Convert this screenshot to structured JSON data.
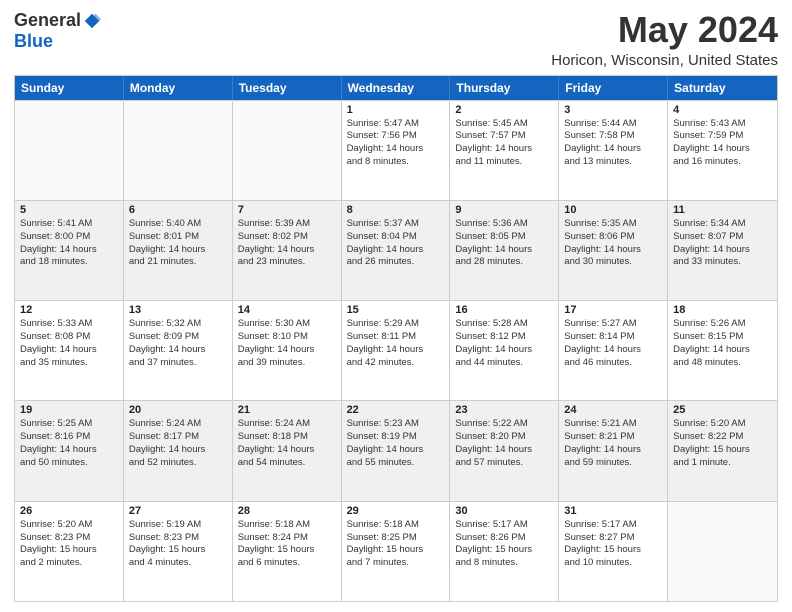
{
  "logo": {
    "general": "General",
    "blue": "Blue"
  },
  "title": "May 2024",
  "location": "Horicon, Wisconsin, United States",
  "days_of_week": [
    "Sunday",
    "Monday",
    "Tuesday",
    "Wednesday",
    "Thursday",
    "Friday",
    "Saturday"
  ],
  "weeks": [
    [
      {
        "day": "",
        "info": ""
      },
      {
        "day": "",
        "info": ""
      },
      {
        "day": "",
        "info": ""
      },
      {
        "day": "1",
        "info": "Sunrise: 5:47 AM\nSunset: 7:56 PM\nDaylight: 14 hours\nand 8 minutes."
      },
      {
        "day": "2",
        "info": "Sunrise: 5:45 AM\nSunset: 7:57 PM\nDaylight: 14 hours\nand 11 minutes."
      },
      {
        "day": "3",
        "info": "Sunrise: 5:44 AM\nSunset: 7:58 PM\nDaylight: 14 hours\nand 13 minutes."
      },
      {
        "day": "4",
        "info": "Sunrise: 5:43 AM\nSunset: 7:59 PM\nDaylight: 14 hours\nand 16 minutes."
      }
    ],
    [
      {
        "day": "5",
        "info": "Sunrise: 5:41 AM\nSunset: 8:00 PM\nDaylight: 14 hours\nand 18 minutes."
      },
      {
        "day": "6",
        "info": "Sunrise: 5:40 AM\nSunset: 8:01 PM\nDaylight: 14 hours\nand 21 minutes."
      },
      {
        "day": "7",
        "info": "Sunrise: 5:39 AM\nSunset: 8:02 PM\nDaylight: 14 hours\nand 23 minutes."
      },
      {
        "day": "8",
        "info": "Sunrise: 5:37 AM\nSunset: 8:04 PM\nDaylight: 14 hours\nand 26 minutes."
      },
      {
        "day": "9",
        "info": "Sunrise: 5:36 AM\nSunset: 8:05 PM\nDaylight: 14 hours\nand 28 minutes."
      },
      {
        "day": "10",
        "info": "Sunrise: 5:35 AM\nSunset: 8:06 PM\nDaylight: 14 hours\nand 30 minutes."
      },
      {
        "day": "11",
        "info": "Sunrise: 5:34 AM\nSunset: 8:07 PM\nDaylight: 14 hours\nand 33 minutes."
      }
    ],
    [
      {
        "day": "12",
        "info": "Sunrise: 5:33 AM\nSunset: 8:08 PM\nDaylight: 14 hours\nand 35 minutes."
      },
      {
        "day": "13",
        "info": "Sunrise: 5:32 AM\nSunset: 8:09 PM\nDaylight: 14 hours\nand 37 minutes."
      },
      {
        "day": "14",
        "info": "Sunrise: 5:30 AM\nSunset: 8:10 PM\nDaylight: 14 hours\nand 39 minutes."
      },
      {
        "day": "15",
        "info": "Sunrise: 5:29 AM\nSunset: 8:11 PM\nDaylight: 14 hours\nand 42 minutes."
      },
      {
        "day": "16",
        "info": "Sunrise: 5:28 AM\nSunset: 8:12 PM\nDaylight: 14 hours\nand 44 minutes."
      },
      {
        "day": "17",
        "info": "Sunrise: 5:27 AM\nSunset: 8:14 PM\nDaylight: 14 hours\nand 46 minutes."
      },
      {
        "day": "18",
        "info": "Sunrise: 5:26 AM\nSunset: 8:15 PM\nDaylight: 14 hours\nand 48 minutes."
      }
    ],
    [
      {
        "day": "19",
        "info": "Sunrise: 5:25 AM\nSunset: 8:16 PM\nDaylight: 14 hours\nand 50 minutes."
      },
      {
        "day": "20",
        "info": "Sunrise: 5:24 AM\nSunset: 8:17 PM\nDaylight: 14 hours\nand 52 minutes."
      },
      {
        "day": "21",
        "info": "Sunrise: 5:24 AM\nSunset: 8:18 PM\nDaylight: 14 hours\nand 54 minutes."
      },
      {
        "day": "22",
        "info": "Sunrise: 5:23 AM\nSunset: 8:19 PM\nDaylight: 14 hours\nand 55 minutes."
      },
      {
        "day": "23",
        "info": "Sunrise: 5:22 AM\nSunset: 8:20 PM\nDaylight: 14 hours\nand 57 minutes."
      },
      {
        "day": "24",
        "info": "Sunrise: 5:21 AM\nSunset: 8:21 PM\nDaylight: 14 hours\nand 59 minutes."
      },
      {
        "day": "25",
        "info": "Sunrise: 5:20 AM\nSunset: 8:22 PM\nDaylight: 15 hours\nand 1 minute."
      }
    ],
    [
      {
        "day": "26",
        "info": "Sunrise: 5:20 AM\nSunset: 8:23 PM\nDaylight: 15 hours\nand 2 minutes."
      },
      {
        "day": "27",
        "info": "Sunrise: 5:19 AM\nSunset: 8:23 PM\nDaylight: 15 hours\nand 4 minutes."
      },
      {
        "day": "28",
        "info": "Sunrise: 5:18 AM\nSunset: 8:24 PM\nDaylight: 15 hours\nand 6 minutes."
      },
      {
        "day": "29",
        "info": "Sunrise: 5:18 AM\nSunset: 8:25 PM\nDaylight: 15 hours\nand 7 minutes."
      },
      {
        "day": "30",
        "info": "Sunrise: 5:17 AM\nSunset: 8:26 PM\nDaylight: 15 hours\nand 8 minutes."
      },
      {
        "day": "31",
        "info": "Sunrise: 5:17 AM\nSunset: 8:27 PM\nDaylight: 15 hours\nand 10 minutes."
      },
      {
        "day": "",
        "info": ""
      }
    ]
  ]
}
